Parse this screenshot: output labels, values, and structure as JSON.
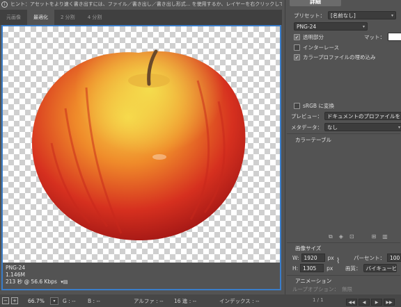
{
  "hint": {
    "text": "ヒント：アセットをより速く書き出すには、ファイル／書き出し／書き出し形式... を使用するか、レイヤーを右クリックして使用。"
  },
  "tabs": [
    {
      "label": "元画像"
    },
    {
      "label": "最適化"
    },
    {
      "label": "2 分割"
    },
    {
      "label": "4 分割"
    }
  ],
  "preview_info": {
    "format": "PNG-24",
    "size": "1.146M",
    "time": "213 秒 @ 56.6 Kbps"
  },
  "status_bar": {
    "zoom": "66.7%",
    "g": "G : --",
    "b": "B : --",
    "alpha": "アルファ : --",
    "hex": "16 進 : --",
    "index": "インデックス : --"
  },
  "panel": {
    "done_label": "詳細",
    "preset_label": "プリセット：",
    "preset_value": "[名前なし]",
    "format_value": "PNG-24",
    "transparency_label": "透明部分",
    "transparency_checked": true,
    "matte_label": "マット：",
    "matte_value": "",
    "interlace_label": "インターレース",
    "interlace_checked": false,
    "embed_profile_label": "カラープロファイルの埋め込み",
    "embed_profile_checked": true,
    "srgb_label": "sRGB に変換",
    "srgb_checked": false,
    "preview_label": "プレビュー：",
    "preview_value": "ドキュメントのプロファイルを使用",
    "metadata_label": "メタデータ：",
    "metadata_value": "なし",
    "color_table_title": "カラーテーブル",
    "image_size_title": "画像サイズ",
    "w_label": "W:",
    "w_value": "1920",
    "h_label": "H:",
    "h_value": "1305",
    "px_unit": "px",
    "percent_label": "パーセント：",
    "percent_value": "100",
    "quality_label": "画質：",
    "quality_value": "バイキュービック",
    "animation_title": "アニメーション",
    "loop_label": "ループオプション：",
    "loop_value": "無限",
    "frame_counter": "1 / 1"
  },
  "colors": {
    "accent_border": "#3a7dc9",
    "panel_bg": "#535353"
  }
}
